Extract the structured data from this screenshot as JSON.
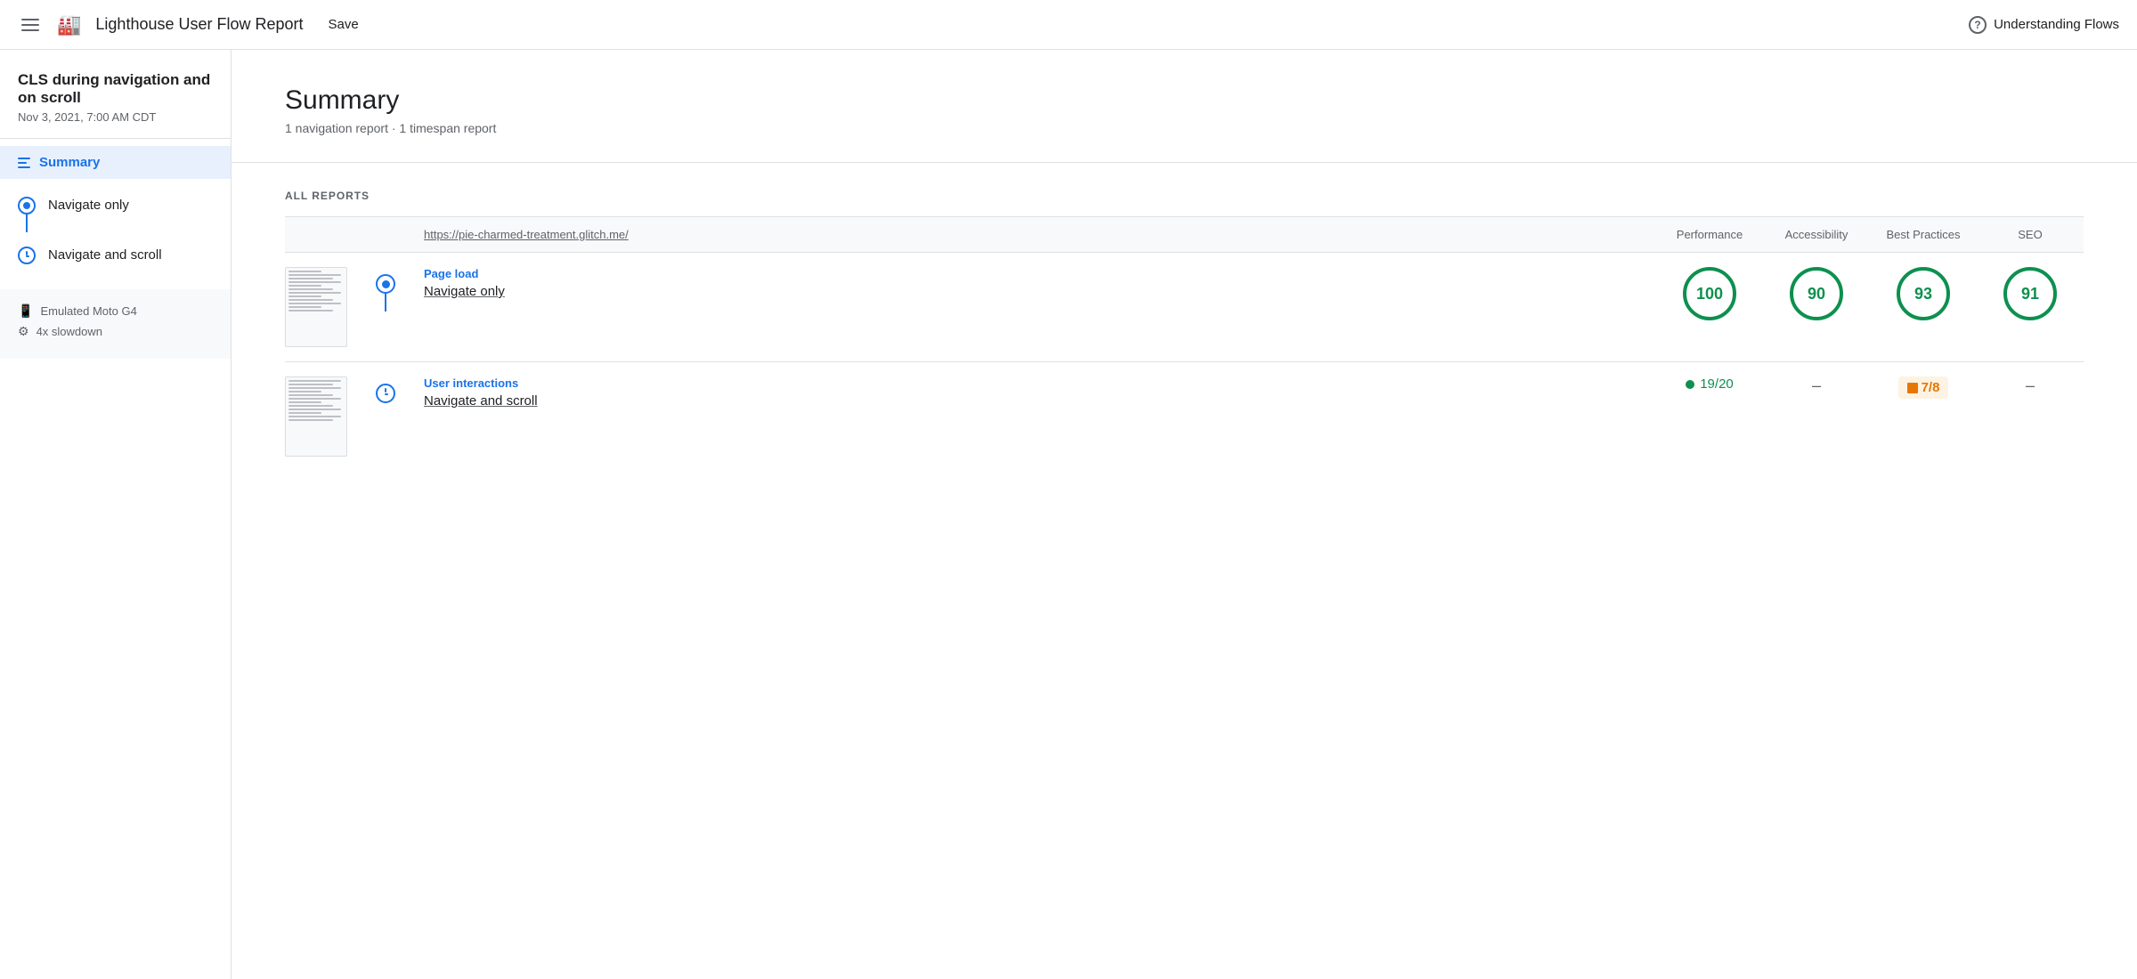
{
  "header": {
    "menu_icon_label": "menu",
    "logo_label": "lighthouse-logo",
    "title": "Lighthouse User Flow Report",
    "save_label": "Save",
    "help_icon_label": "help",
    "understanding_label": "Understanding Flows"
  },
  "sidebar": {
    "project_title": "CLS during navigation and on scroll",
    "date": "Nov 3, 2021, 7:00 AM CDT",
    "summary_label": "Summary",
    "nav_items": [
      {
        "label": "Navigate only",
        "type": "circle"
      },
      {
        "label": "Navigate and scroll",
        "type": "clock"
      }
    ],
    "meta": [
      {
        "icon": "device",
        "text": "Emulated Moto G4"
      },
      {
        "icon": "cpu",
        "text": "4x slowdown"
      }
    ]
  },
  "content": {
    "summary_title": "Summary",
    "summary_subtitle": "1 navigation report · 1 timespan report",
    "all_reports_label": "ALL REPORTS",
    "table_columns": {
      "url": "https://pie-charmed-treatment.glitch.me/",
      "performance": "Performance",
      "accessibility": "Accessibility",
      "best_practices": "Best Practices",
      "seo": "SEO"
    },
    "reports": [
      {
        "type": "Page load",
        "name": "Navigate only",
        "timeline_type": "circle",
        "scores": {
          "performance": 100,
          "accessibility": 90,
          "best_practices": 93,
          "seo": 91
        }
      },
      {
        "type": "User interactions",
        "name": "Navigate and scroll",
        "timeline_type": "clock",
        "scores": {
          "performance": "19/20",
          "performance_type": "dot-green",
          "accessibility": "–",
          "best_practices": "7/8",
          "best_practices_type": "badge-orange",
          "seo": "–"
        }
      }
    ]
  }
}
